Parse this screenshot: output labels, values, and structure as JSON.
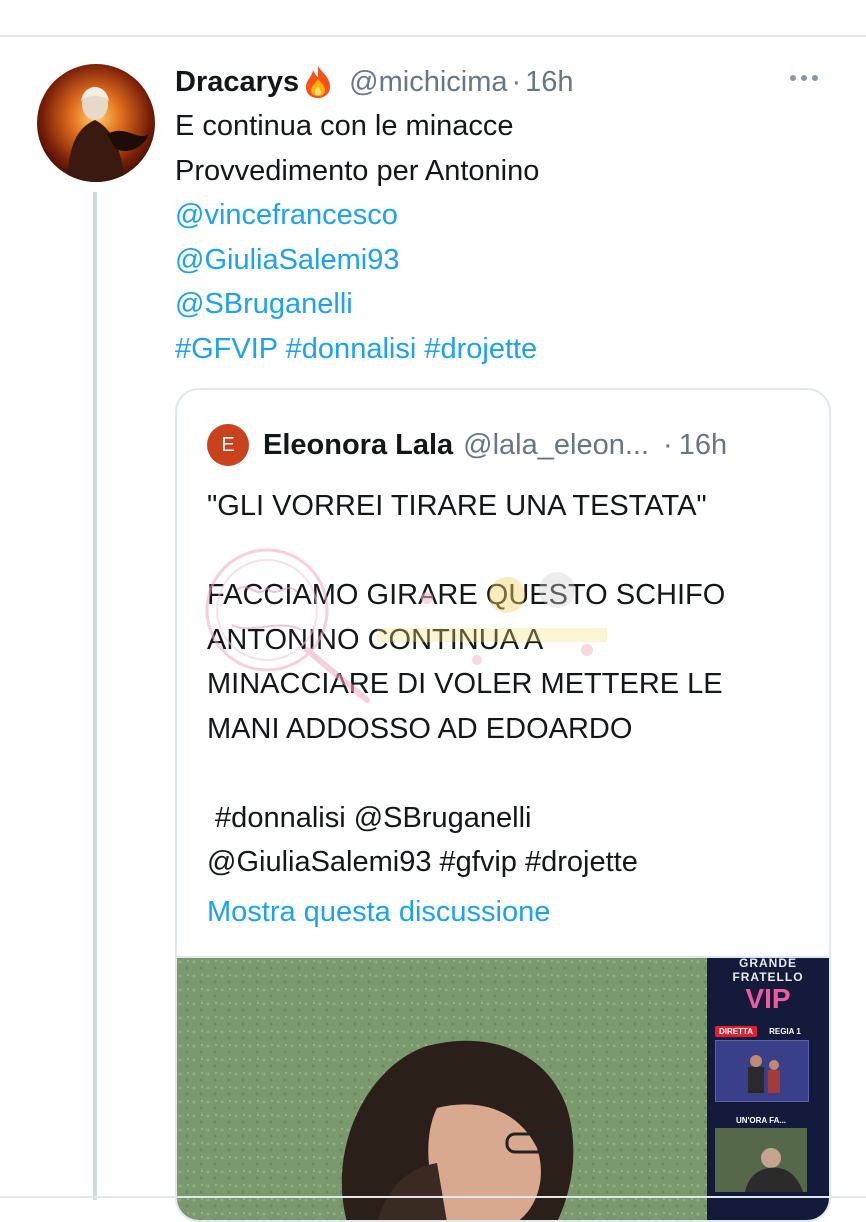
{
  "tweet": {
    "author": {
      "display_name": "Dracarys",
      "emoji": "fire",
      "handle": "@michicima",
      "time": "16h"
    },
    "body": {
      "line1": "E continua con le minacce",
      "line2": "Provvedimento per Antonino",
      "mentions": [
        "@vincefrancesco",
        "@GiuliaSalemi93",
        "@SBruganelli"
      ],
      "hashtags": "#GFVIP #donnalisi #drojette"
    },
    "separator": "·"
  },
  "quote": {
    "avatar_letter": "E",
    "display_name": "Eleonora Lala",
    "handle": "@lala_eleon...",
    "separator": "·",
    "time": "16h",
    "lines": [
      "\"GLI VORREI TIRARE UNA TESTATA\"",
      "",
      "FACCIAMO GIRARE QUESTO SCHIFO",
      "ANTONINO CONTINUA A",
      "MINACCIARE DI VOLER METTERE LE",
      "MANI ADDOSSO AD EDOARDO",
      "",
      " #donnalisi @SBruganelli",
      "@GiuliaSalemi93 #gfvip #drojette"
    ],
    "show_thread": "Mostra questa discussione",
    "media": {
      "logo_line1": "GRANDE",
      "logo_line2": "FRATELLO",
      "logo_line3": "VIP",
      "live_badge": "DIRETTA",
      "regia": "REGIA 1",
      "un_ora_fa": "UN'ORA FA..."
    }
  },
  "colors": {
    "link": "#1da1f2",
    "secondary_text": "#657786",
    "border": "#e1e8ed",
    "quote_avatar": "#c9421d"
  }
}
